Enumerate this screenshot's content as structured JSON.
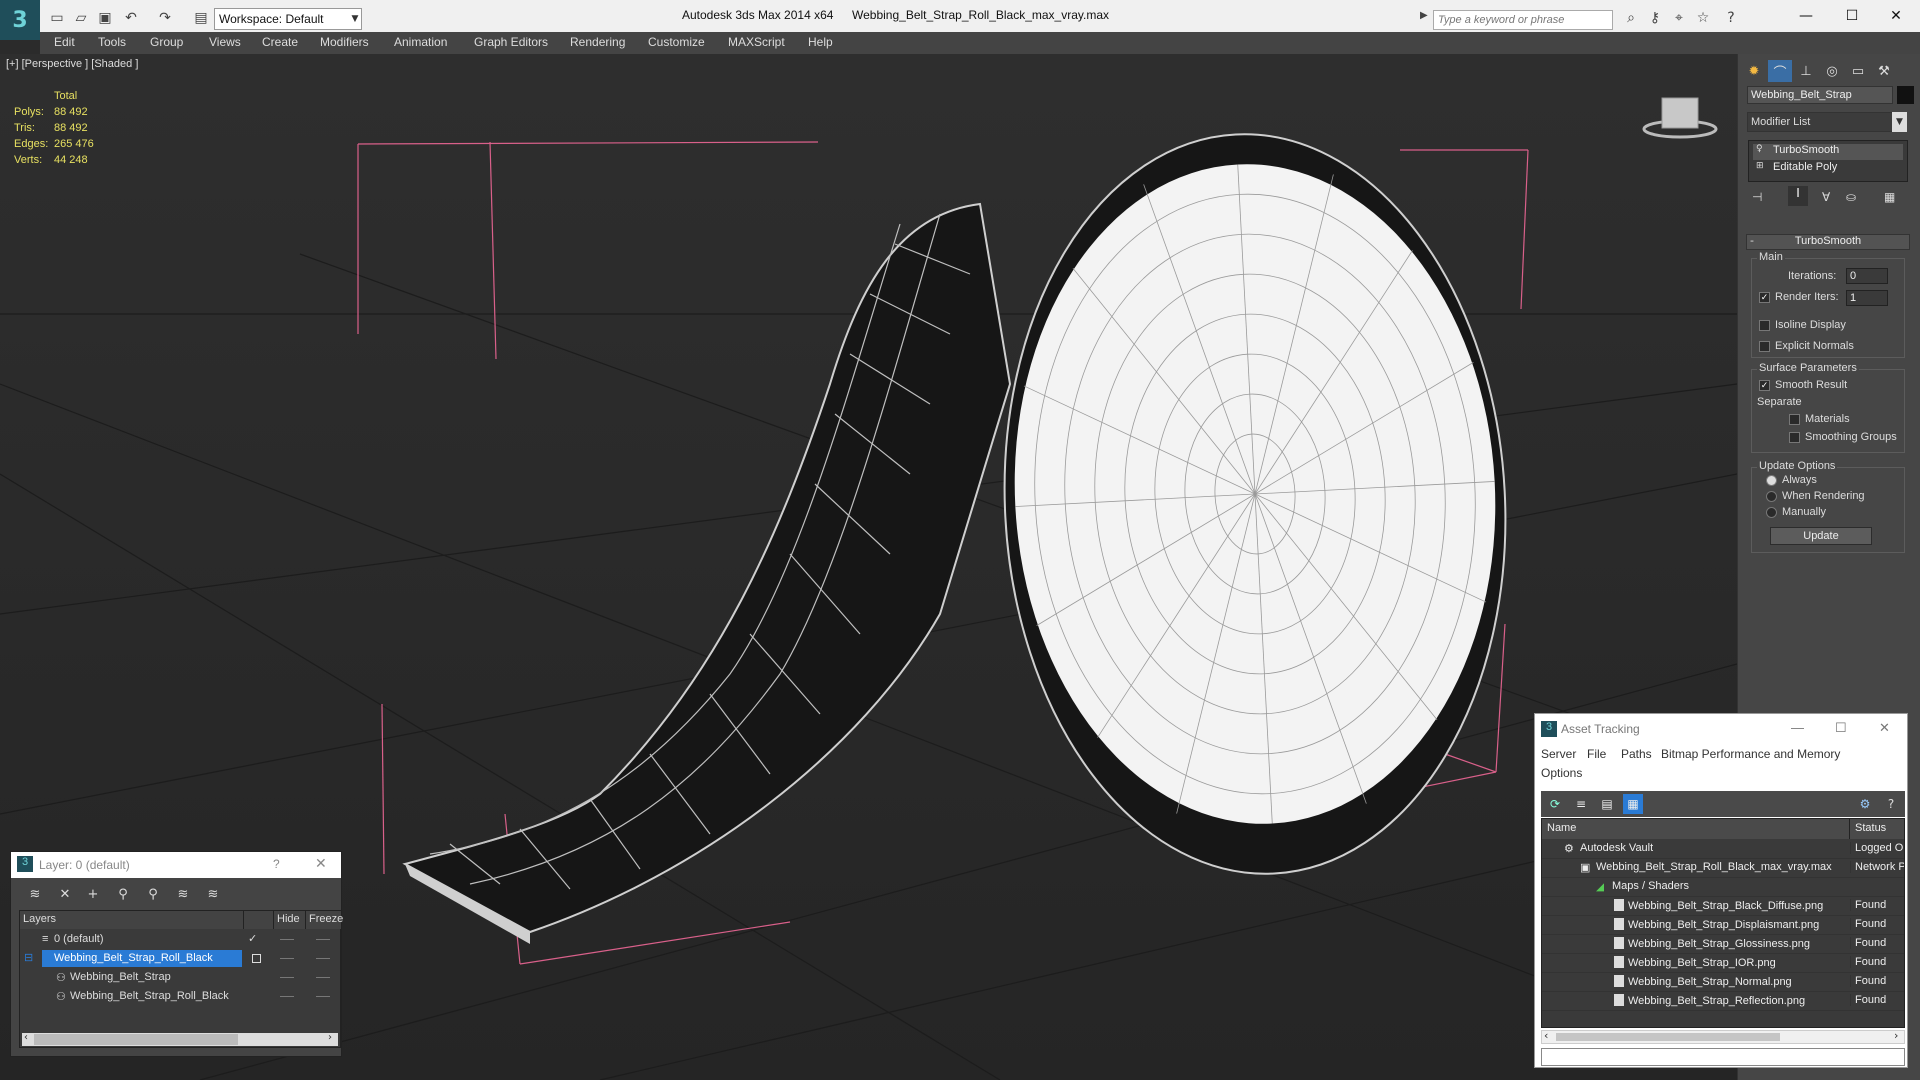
{
  "titlebar": {
    "app_title": "Autodesk 3ds Max  2014 x64",
    "file_title": "Webbing_Belt_Strap_Roll_Black_max_vray.max",
    "workspace": "Workspace: Default",
    "search_placeholder": "Type a keyword or phrase"
  },
  "menu": [
    "Edit",
    "Tools",
    "Group",
    "Views",
    "Create",
    "Modifiers",
    "Animation",
    "Graph Editors",
    "Rendering",
    "Customize",
    "MAXScript",
    "Help"
  ],
  "viewport": {
    "label": "[+] [Perspective ] [Shaded ]",
    "stats": {
      "title": "Total",
      "rows": [
        {
          "label": "Polys:",
          "value": "88 492"
        },
        {
          "label": "Tris:",
          "value": "88 492"
        },
        {
          "label": "Edges:",
          "value": "265 476"
        },
        {
          "label": "Verts:",
          "value": "44 248"
        }
      ]
    }
  },
  "command_panel": {
    "object_name": "Webbing_Belt_Strap",
    "modifier_list": "Modifier List",
    "stack": [
      "TurboSmooth",
      "Editable Poly"
    ],
    "rollout_title": "TurboSmooth",
    "main_label": "Main",
    "iterations_label": "Iterations:",
    "iterations_value": "0",
    "render_iters_label": "Render Iters:",
    "render_iters_value": "1",
    "isoline": "Isoline Display",
    "explicit_normals": "Explicit Normals",
    "surface_params": "Surface Parameters",
    "smooth_result": "Smooth Result",
    "separate": "Separate",
    "materials": "Materials",
    "smoothing_groups": "Smoothing Groups",
    "update_options": "Update Options",
    "always": "Always",
    "when_rendering": "When Rendering",
    "manually": "Manually",
    "update_button": "Update"
  },
  "layer_window": {
    "title": "Layer: 0 (default)",
    "help": "?",
    "columns": [
      "Layers",
      "Hide",
      "Freeze"
    ],
    "rows": [
      {
        "name": "0 (default)"
      },
      {
        "name": "Webbing_Belt_Strap_Roll_Black"
      },
      {
        "name": "Webbing_Belt_Strap"
      },
      {
        "name": "Webbing_Belt_Strap_Roll_Black"
      }
    ]
  },
  "asset_tracking": {
    "title": "Asset Tracking",
    "menu": [
      "Server",
      "File",
      "Paths",
      "Bitmap Performance and Memory",
      "Options"
    ],
    "columns": [
      "Name",
      "Status"
    ],
    "rows": [
      {
        "name": "Autodesk Vault",
        "status": "Logged Ou"
      },
      {
        "name": "Webbing_Belt_Strap_Roll_Black_max_vray.max",
        "status": "Network Pa"
      },
      {
        "name": "Maps / Shaders",
        "status": ""
      },
      {
        "name": "Webbing_Belt_Strap_Black_Diffuse.png",
        "status": "Found"
      },
      {
        "name": "Webbing_Belt_Strap_Displaismant.png",
        "status": "Found"
      },
      {
        "name": "Webbing_Belt_Strap_Glossiness.png",
        "status": "Found"
      },
      {
        "name": "Webbing_Belt_Strap_IOR.png",
        "status": "Found"
      },
      {
        "name": "Webbing_Belt_Strap_Normal.png",
        "status": "Found"
      },
      {
        "name": "Webbing_Belt_Strap_Reflection.png",
        "status": "Found"
      }
    ]
  }
}
